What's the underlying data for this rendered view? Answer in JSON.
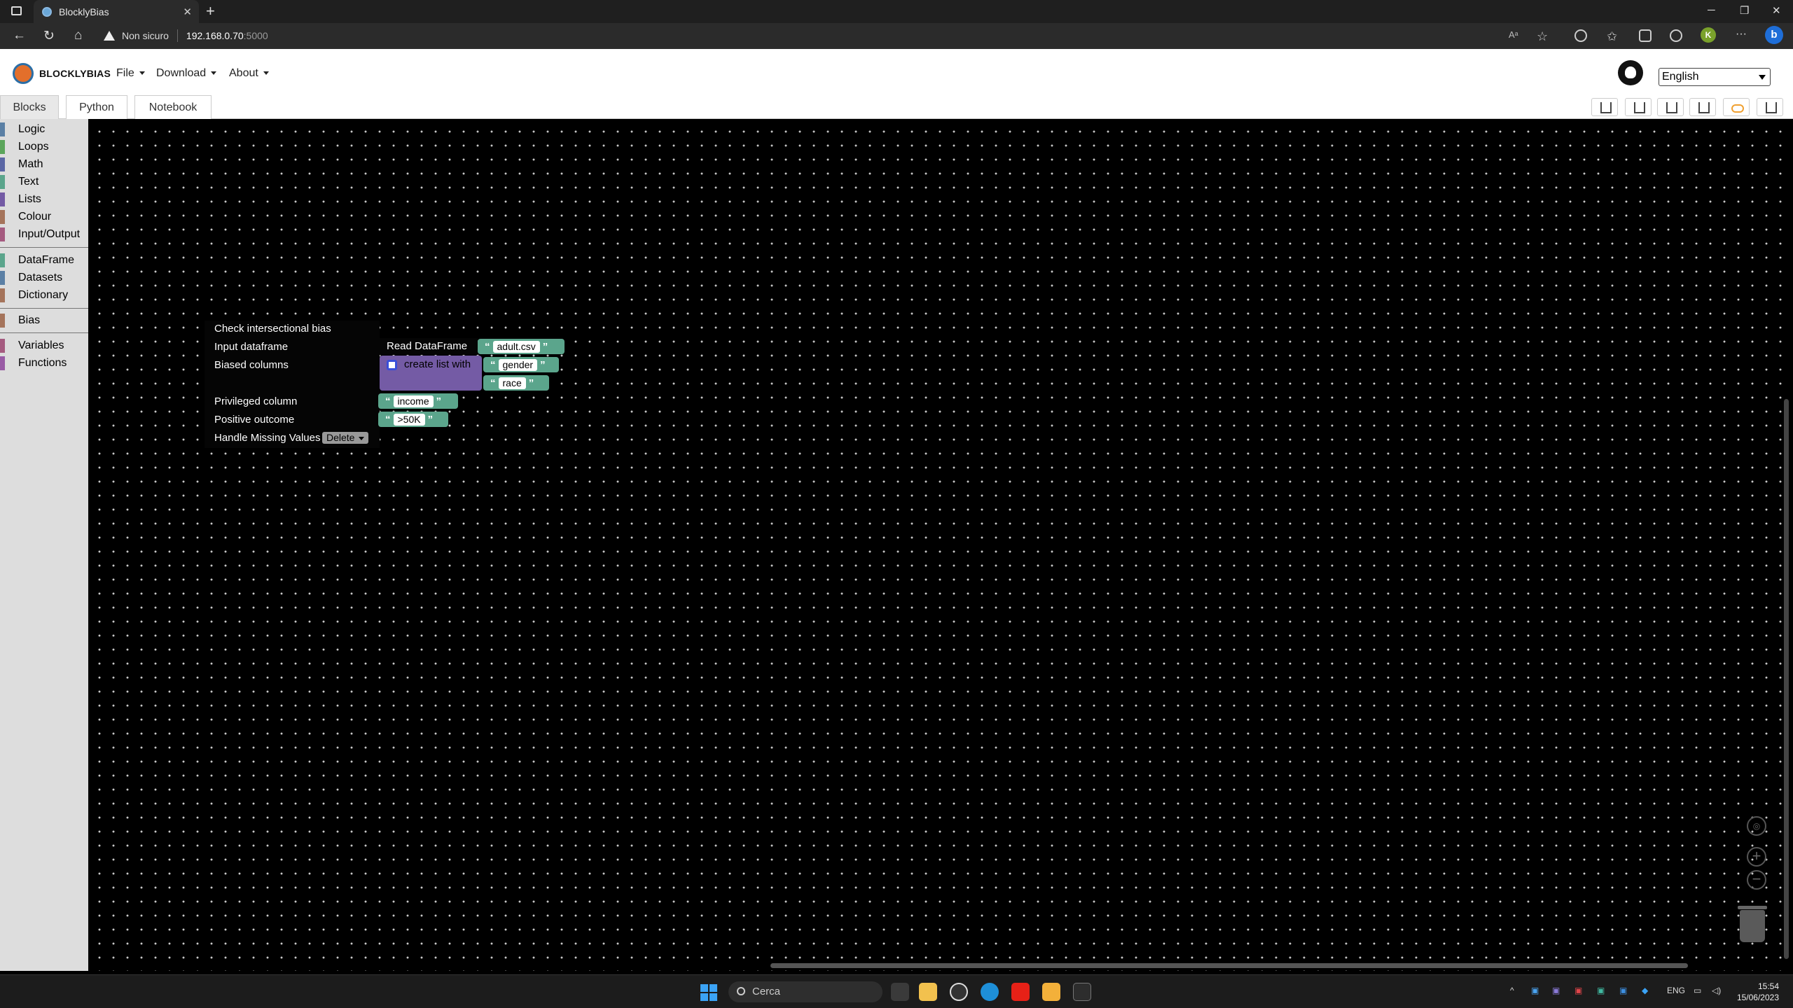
{
  "browser": {
    "tab_title": "BlocklyBias",
    "security_label": "Non sicuro",
    "url_host": "192.168.0.70",
    "url_port": ":5000",
    "profile_initial": "K",
    "bing_label": "b"
  },
  "header": {
    "brand": "BLOCKLYBIAS",
    "menus": [
      "File",
      "Download",
      "About"
    ],
    "language": "English"
  },
  "tabs": [
    "Blocks",
    "Python",
    "Notebook"
  ],
  "toolbar_actions": [
    "download-icon",
    "upload-icon",
    "edit-icon",
    "copy-icon",
    "link-icon",
    "trash-icon"
  ],
  "toolbox": {
    "items": [
      {
        "label": "Logic",
        "color": "#5b80a5"
      },
      {
        "label": "Loops",
        "color": "#5ba55b"
      },
      {
        "label": "Math",
        "color": "#5b67a5"
      },
      {
        "label": "Text",
        "color": "#5ba58c"
      },
      {
        "label": "Lists",
        "color": "#745ba5"
      },
      {
        "label": "Colour",
        "color": "#a5745b"
      },
      {
        "label": "Input/Output",
        "color": "#a55b80"
      },
      {
        "label": "DataFrame",
        "color": "#5ba58c"
      },
      {
        "label": "Datasets",
        "color": "#5b80a5"
      },
      {
        "label": "Dictionary",
        "color": "#a5745b"
      },
      {
        "label": "Bias",
        "color": "#a5745b"
      },
      {
        "label": "Variables",
        "color": "#a55b80"
      },
      {
        "label": "Functions",
        "color": "#995ba5"
      }
    ]
  },
  "blocks": {
    "main_title": "Check intersectional bias",
    "input_dataframe_label": "Input dataframe",
    "biased_columns_label": "Biased columns",
    "privileged_column_label": "Privileged column",
    "positive_outcome_label": "Positive outcome",
    "handle_missing_label": "Handle Missing Values",
    "handle_missing_value": "Delete",
    "read_dataframe_label": "Read DataFrame",
    "read_dataframe_file": "adult.csv",
    "create_list_label": "create list with",
    "list_items": [
      "gender",
      "race"
    ],
    "privileged_value": "income",
    "positive_value": ">50K",
    "quote_open": "“",
    "quote_close": "”"
  },
  "taskbar": {
    "search_placeholder": "Cerca",
    "language": "ENG",
    "time": "15:54",
    "date": "15/06/2023"
  }
}
